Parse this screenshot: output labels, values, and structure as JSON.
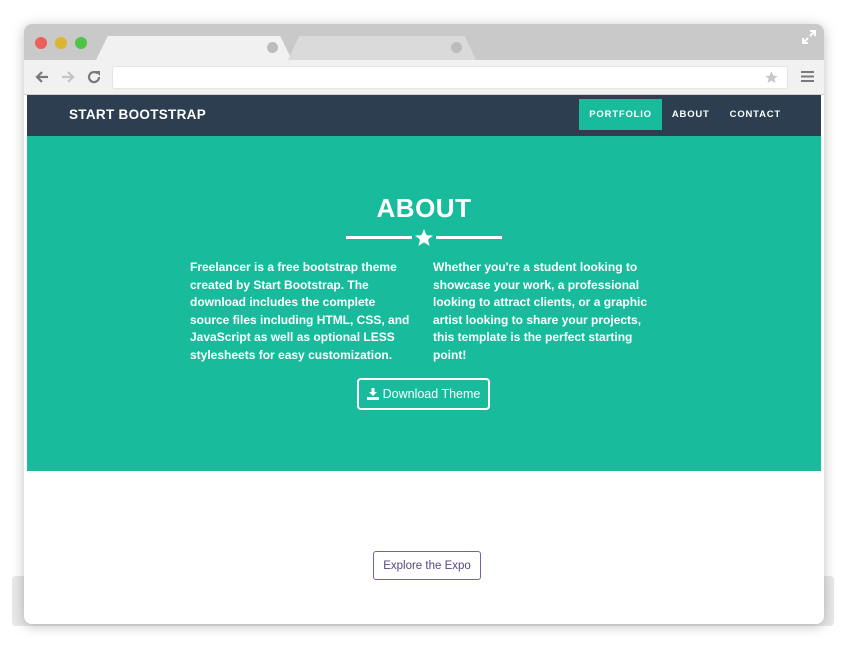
{
  "browser": {
    "window_controls": [
      "close",
      "minimize",
      "maximize"
    ],
    "tabs": [
      {
        "label": ""
      },
      {
        "label": ""
      }
    ],
    "address_bar": {
      "url": ""
    }
  },
  "navbar": {
    "brand": "START BOOTSTRAP",
    "links": [
      {
        "label": "PORTFOLIO",
        "active": true
      },
      {
        "label": "ABOUT",
        "active": false
      },
      {
        "label": "CONTACT",
        "active": false
      }
    ]
  },
  "about": {
    "title": "ABOUT",
    "left_text": "Freelancer is a free bootstrap theme created by Start Bootstrap. The download includes the complete source files including HTML, CSS, and JavaScript as well as optional LESS stylesheets for easy customization.",
    "right_text": "Whether you're a student looking to showcase your work, a professional looking to attract clients, or a graphic artist looking to share your projects, this template is the perfect starting point!",
    "download_label": "Download Theme"
  },
  "expo_button": {
    "label": "Explore the Expo"
  },
  "colors": {
    "navbar_bg": "#2c3e50",
    "accent": "#18bc9c",
    "expo_border": "#7b5ea7"
  },
  "icons": [
    "back-icon",
    "forward-icon",
    "reload-icon",
    "star-icon",
    "menu-icon",
    "expand-icon",
    "divider-star-icon",
    "download-icon"
  ]
}
